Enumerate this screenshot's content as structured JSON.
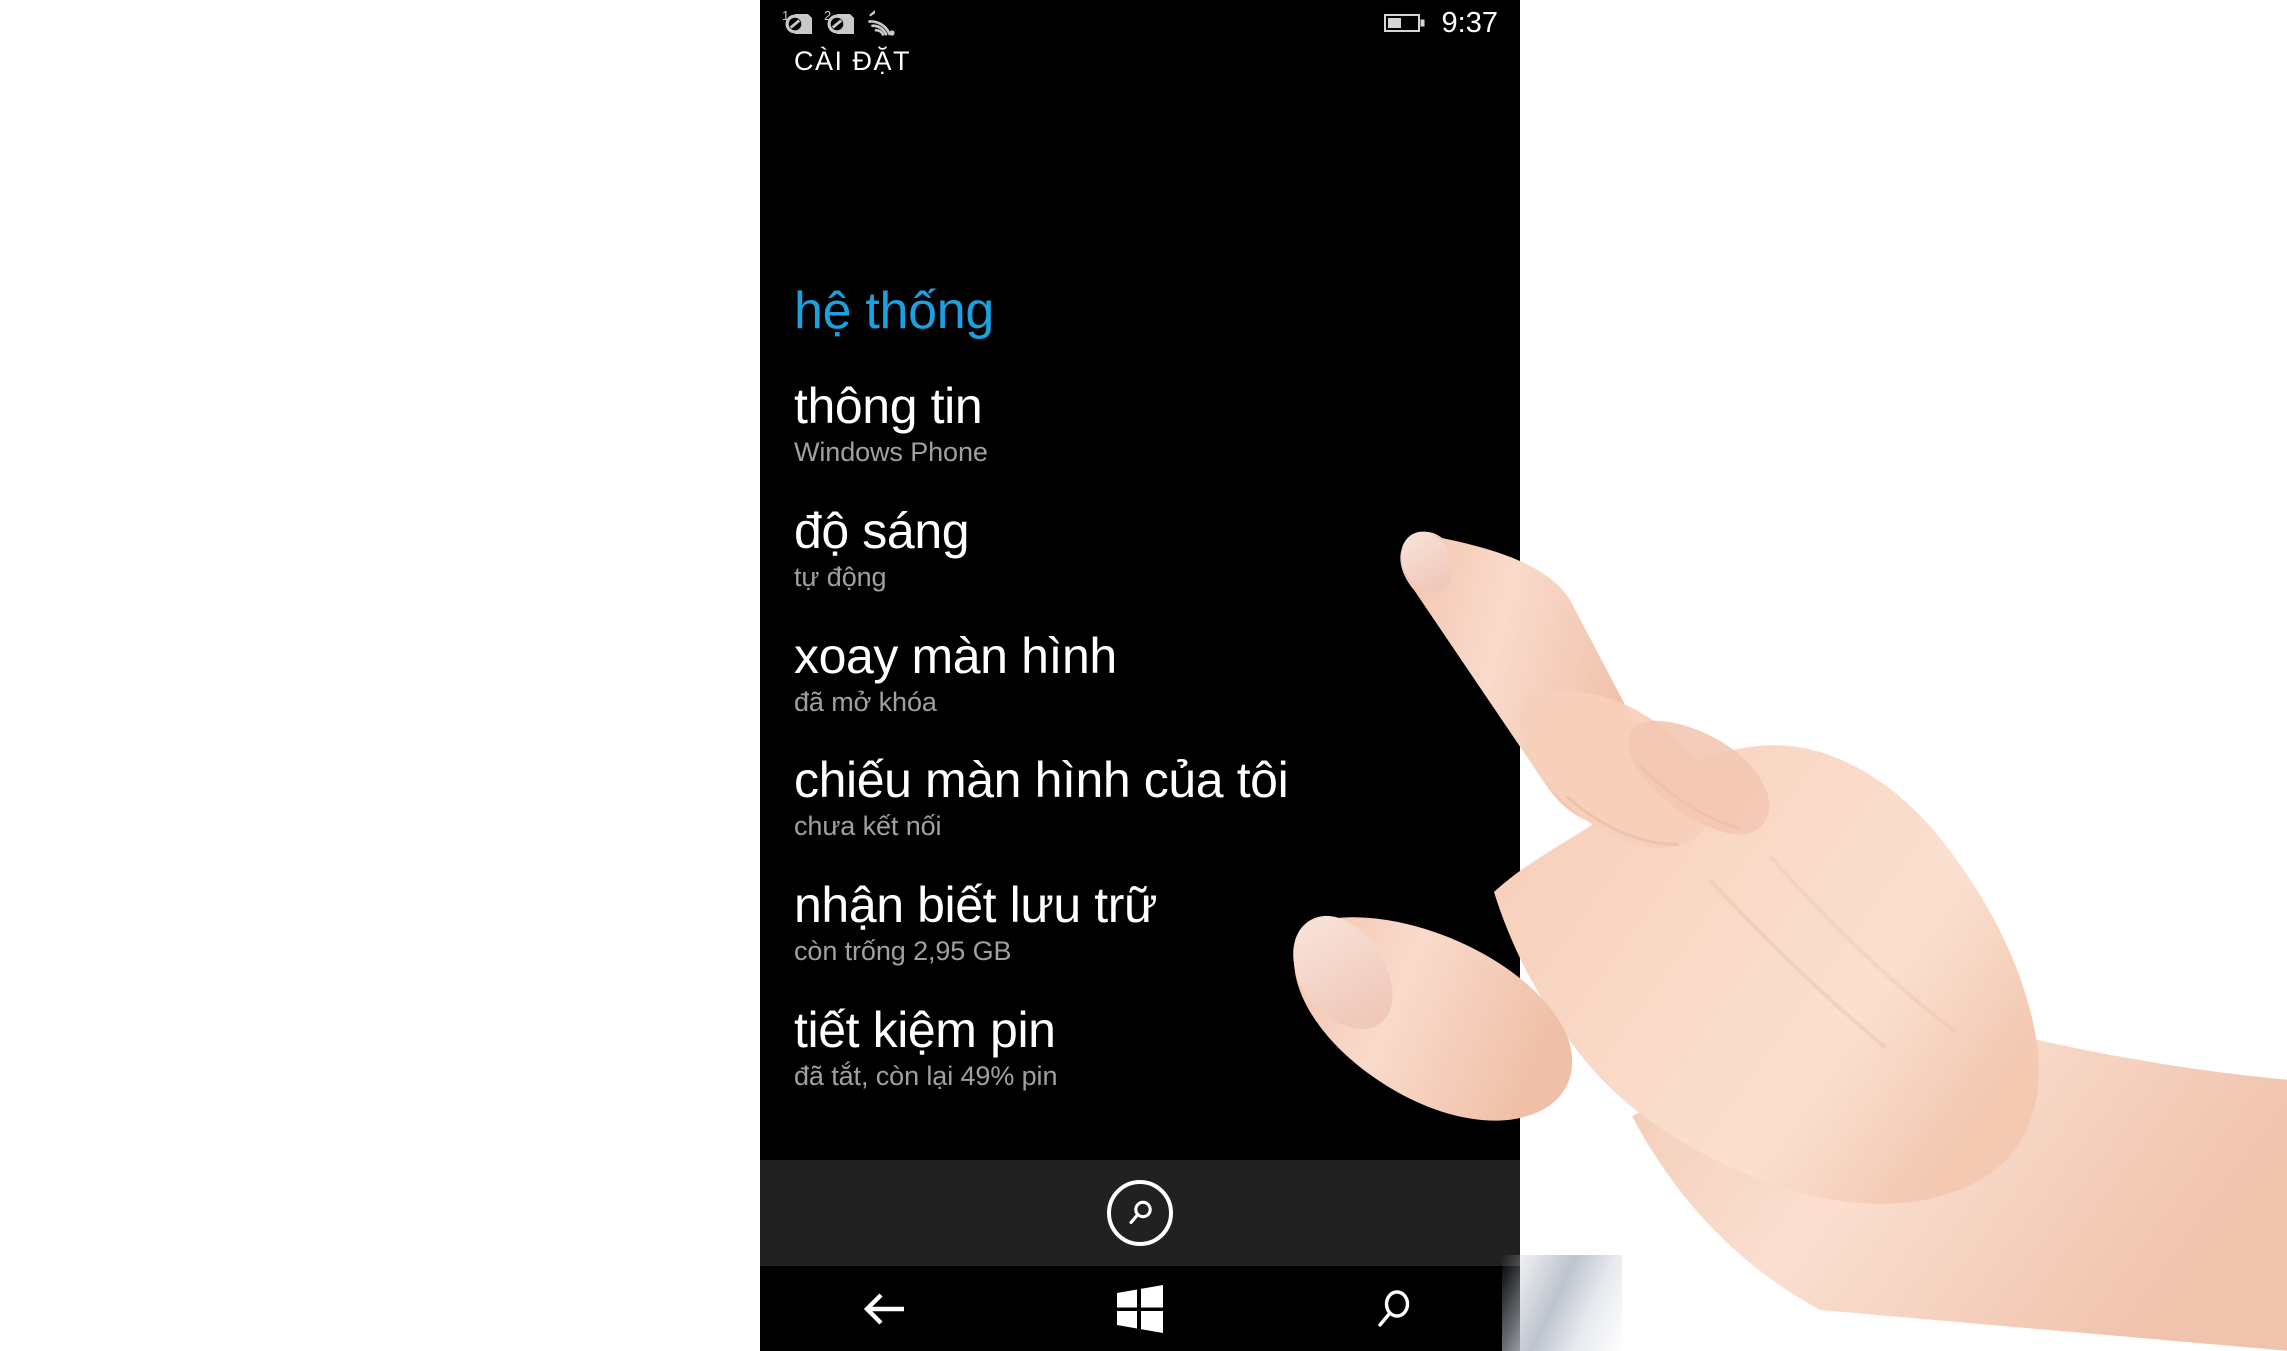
{
  "status_bar": {
    "sim1_label": "1",
    "sim1_icon": "sim-no-service-icon",
    "sim2_label": "2",
    "sim2_icon": "sim-no-service-icon",
    "wifi_icon": "wifi-icon",
    "battery_icon": "battery-icon",
    "clock": "9:37"
  },
  "header": {
    "title": "CÀI ĐẶT"
  },
  "pivot": {
    "section_label": "hệ thống"
  },
  "settings": {
    "items": [
      {
        "title": "thông tin",
        "subtitle": "Windows Phone"
      },
      {
        "title": "độ sáng",
        "subtitle": "tự động"
      },
      {
        "title": "xoay màn hình",
        "subtitle": "đã mở khóa"
      },
      {
        "title": "chiếu màn hình của tôi",
        "subtitle": "chưa kết nối"
      },
      {
        "title": "nhận biết lưu trữ",
        "subtitle": "còn trống 2,95 GB"
      },
      {
        "title": "tiết kiệm pin",
        "subtitle": "đã tắt, còn lại 49% pin"
      }
    ]
  },
  "app_bar": {
    "search_icon": "search-icon"
  },
  "nav_bar": {
    "back_icon": "back-arrow-icon",
    "start_icon": "windows-logo-icon",
    "search_icon": "search-icon"
  },
  "colors": {
    "accent_blue": "#1ba1e2",
    "screen_background": "#000000",
    "app_bar_background": "#212121",
    "title_text": "#ffffff",
    "subtitle_text": "#a0a0a0",
    "page_background": "#ffffff"
  }
}
